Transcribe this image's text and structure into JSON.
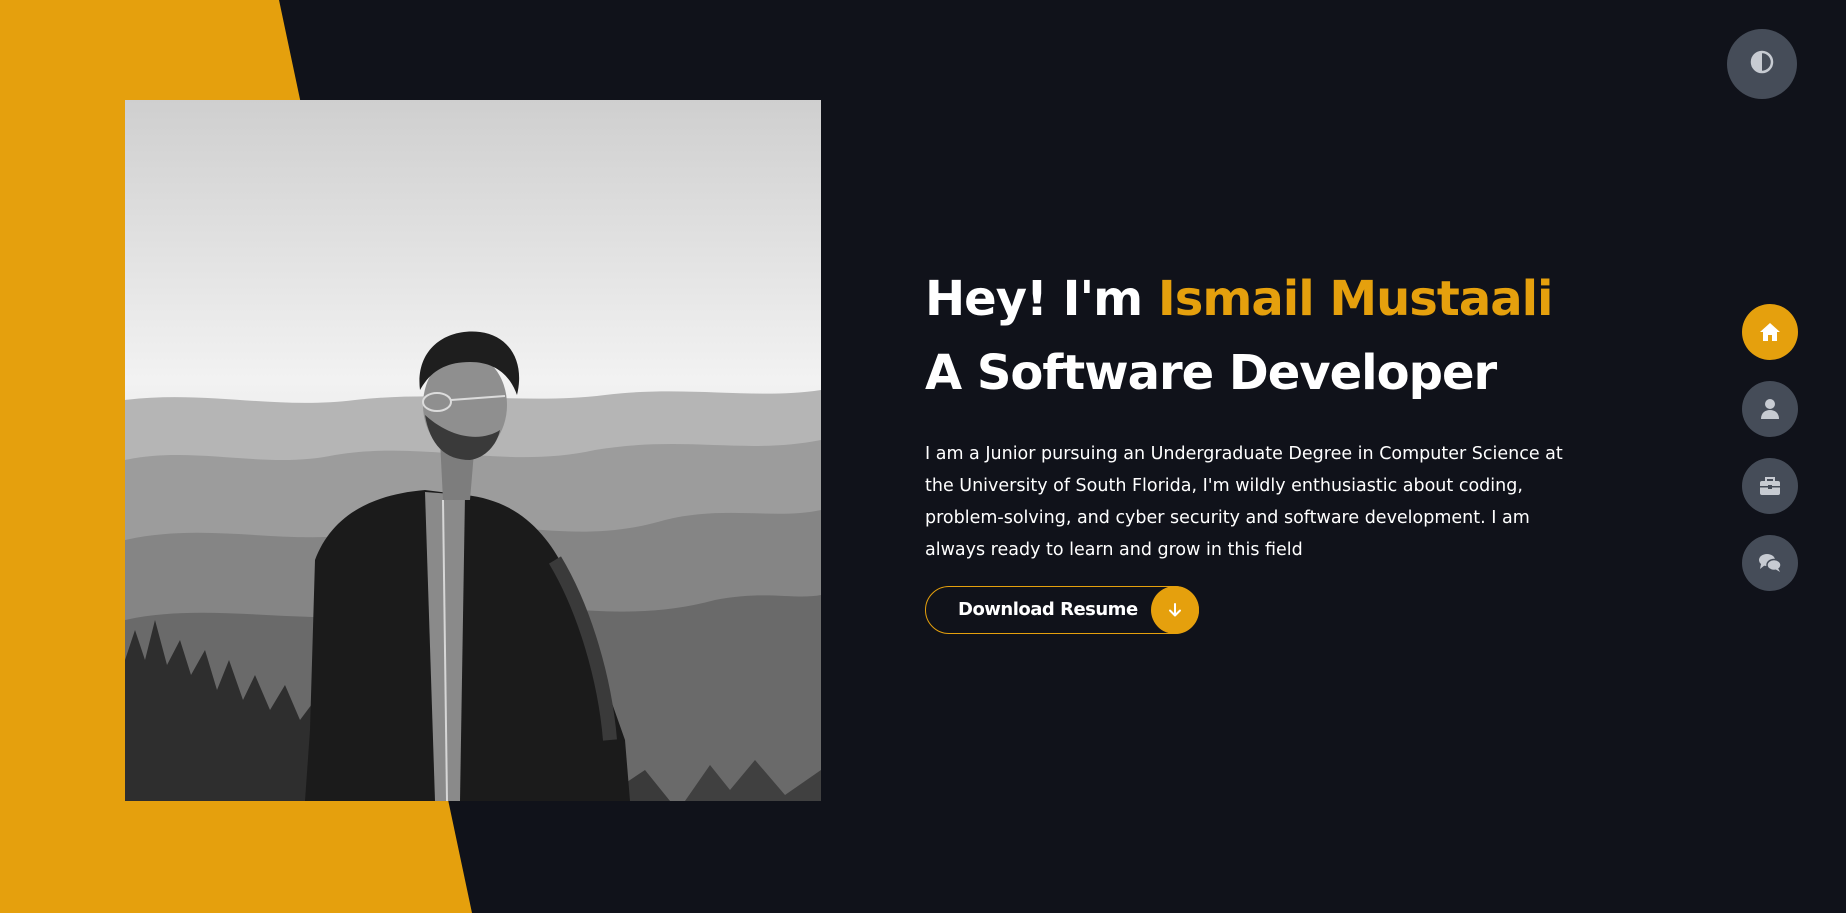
{
  "colors": {
    "accent": "#e5a00d",
    "background": "#10121a",
    "nav_button": "#454c58",
    "text": "#ffffff"
  },
  "hero": {
    "title_prefix": "Hey! I'm ",
    "name": "Ismail Mustaali",
    "title_suffix": " A Software Developer",
    "description": "I am a Junior pursuing an Undergraduate Degree in Computer Science at the University of South Florida, I'm wildly enthusiastic about coding, problem-solving, and cyber security and software development. I am always ready to learn and grow in this field"
  },
  "resume_button": {
    "label": "Download Resume",
    "icon": "arrow-down-icon"
  },
  "theme_toggle": {
    "icon": "contrast-icon"
  },
  "side_nav": {
    "items": [
      {
        "icon": "home-icon",
        "active": true
      },
      {
        "icon": "user-icon",
        "active": false
      },
      {
        "icon": "briefcase-icon",
        "active": false
      },
      {
        "icon": "comments-icon",
        "active": false
      }
    ]
  },
  "profile_photo": {
    "style": "black-and-white portrait, mountain landscape background"
  }
}
